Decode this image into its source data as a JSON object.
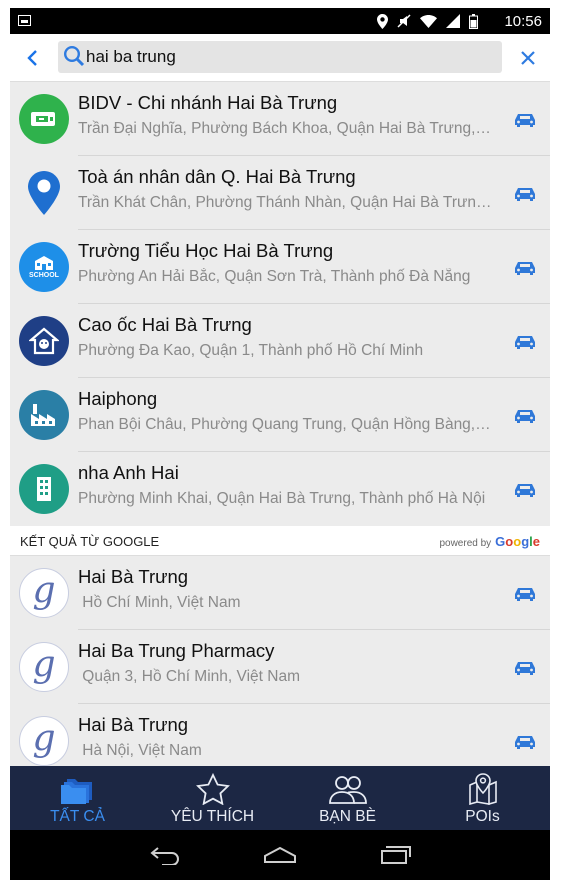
{
  "status_bar": {
    "time": "10:56"
  },
  "search": {
    "value": "hai ba trung",
    "placeholder": ""
  },
  "results": [
    {
      "title": "BIDV - Chi nhánh Hai Bà Trưng",
      "subtitle": "Trần Đại Nghĩa, Phường Bách Khoa, Quận Hai Bà Trưng, Hà Nội",
      "icon": "bank-icon",
      "color": "#2fb24c"
    },
    {
      "title": "Toà án nhân dân Q. Hai Bà Trưng",
      "subtitle": "Trần Khát Chân, Phường Thánh Nhàn, Quận Hai Bà Trưng, Hà Nội",
      "icon": "map-pin-icon",
      "color": "#1f6fd0"
    },
    {
      "title": "Trường Tiểu Học Hai Bà Trưng",
      "subtitle": "Phường An Hải Bắc, Quận Sơn Trà, Thành phố Đà Nẵng",
      "icon": "school-icon",
      "color": "#1e8fe8",
      "icon_text": "SCHOOL"
    },
    {
      "title": "Cao ốc Hai Bà Trưng",
      "subtitle": "Phường Đa Kao, Quận 1, Thành phố Hồ Chí Minh",
      "icon": "house-icon",
      "color": "#1f3f86"
    },
    {
      "title": "Haiphong",
      "subtitle": "Phan Bội Châu, Phường Quang Trung, Quận Hồng Bàng, Hải Phòng",
      "icon": "factory-icon",
      "color": "#2a7fa6"
    },
    {
      "title": "nha Anh Hai",
      "subtitle": "Phường Minh Khai, Quận Hai Bà Trưng, Thành phố Hà Nội",
      "icon": "building-icon",
      "color": "#1f9e86"
    }
  ],
  "google_section": {
    "label": "KẾT QUẢ TỪ GOOGLE",
    "powered_by": "powered by",
    "logo_letters": [
      "G",
      "o",
      "o",
      "g",
      "l",
      "e"
    ]
  },
  "google_results": [
    {
      "title": "Hai Bà Trưng",
      "subtitle": " Hồ Chí Minh, Việt Nam",
      "icon_letter": "g"
    },
    {
      "title": "Hai Ba Trung Pharmacy",
      "subtitle": " Quận 3, Hồ Chí Minh, Việt Nam",
      "icon_letter": "g"
    },
    {
      "title": "Hai Bà Trưng",
      "subtitle": " Hà Nội, Việt Nam",
      "icon_letter": "g"
    }
  ],
  "tabs": [
    {
      "label": "TẤT CẢ",
      "icon": "stack-icon",
      "active": true
    },
    {
      "label": "YÊU THÍCH",
      "icon": "star-icon",
      "active": false
    },
    {
      "label": "BẠN BÈ",
      "icon": "friends-icon",
      "active": false
    },
    {
      "label": "POIs",
      "icon": "poi-map-icon",
      "active": false
    }
  ],
  "colors": {
    "accent": "#1a73e8",
    "tab_bar": "#1c2744",
    "tab_active": "#3a8ef0",
    "car": "#2f78d8"
  }
}
